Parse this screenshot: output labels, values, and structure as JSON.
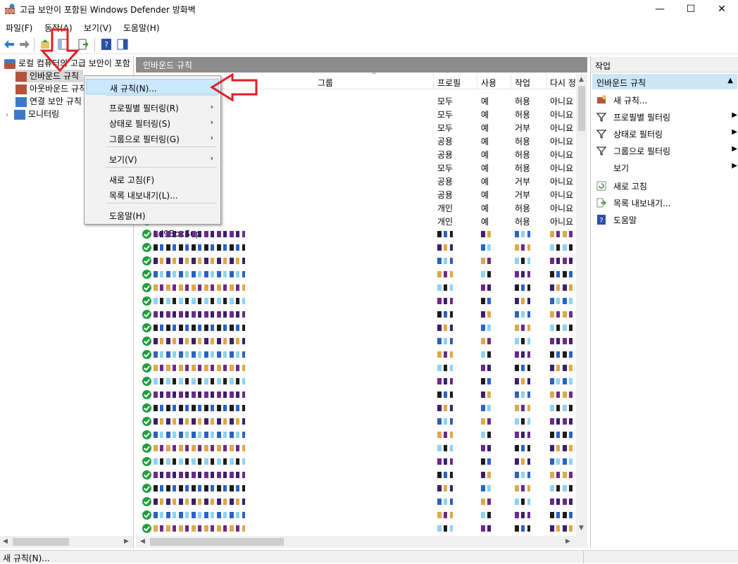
{
  "window": {
    "title": "고급 보안이 포함된 Windows Defender 방화벽",
    "minimize": "—",
    "maximize": "☐",
    "close": "✕"
  },
  "menubar": [
    "파일(F)",
    "동작(A)",
    "보기(V)",
    "도움말(H)"
  ],
  "tree": {
    "root": "로컬 컴퓨터의 고급 보안이 포함",
    "items": [
      "인바운드 규칙",
      "아웃바운드 규칙",
      "연결 보안 규칙",
      "모니터링"
    ]
  },
  "center": {
    "header": "인바운드 규칙",
    "columns": [
      "그룹",
      "프로필",
      "사용",
      "작업",
      "다시 정"
    ],
    "rows": [
      {
        "profile": "모두",
        "enabled": "예",
        "action": "허용",
        "override": "아니요"
      },
      {
        "profile": "모두",
        "enabled": "예",
        "action": "허용",
        "override": "아니요"
      },
      {
        "profile": "모두",
        "enabled": "예",
        "action": "거부",
        "override": "아니요"
      },
      {
        "profile": "공용",
        "enabled": "예",
        "action": "허용",
        "override": "아니요"
      },
      {
        "profile": "공용",
        "enabled": "예",
        "action": "허용",
        "override": "아니요"
      },
      {
        "profile": "모두",
        "enabled": "예",
        "action": "허용",
        "override": "아니요"
      },
      {
        "profile": "공용",
        "enabled": "예",
        "action": "거부",
        "override": "아니요"
      },
      {
        "profile": "공용",
        "enabled": "예",
        "action": "거부",
        "override": "아니요"
      },
      {
        "profile": "개인",
        "enabled": "예",
        "action": "허용",
        "override": "아니요"
      },
      {
        "profile": "개인",
        "enabled": "예",
        "action": "허용",
        "override": "아니요"
      }
    ],
    "partial_row_name": "Ld9BoxSup",
    "last_row": {
      "name": "SoftEther VPN Client Connection Mana...",
      "profile": "모두",
      "enabled": "예",
      "action": "허용",
      "override": "아니요"
    },
    "name_partial_label": "e"
  },
  "context_menu": {
    "items": [
      {
        "label": "새 규칙(N)...",
        "submenu": false
      },
      {
        "label": "프로필별 필터링(R)",
        "submenu": true
      },
      {
        "label": "상태로 필터링(S)",
        "submenu": true
      },
      {
        "label": "그룹으로 필터링(G)",
        "submenu": true
      },
      {
        "label": "보기(V)",
        "submenu": true
      },
      {
        "label": "새로 고침(F)",
        "submenu": false
      },
      {
        "label": "목록 내보내기(L)...",
        "submenu": false
      },
      {
        "label": "도움말(H)",
        "submenu": false
      }
    ],
    "submenu_arrow": "›"
  },
  "actions": {
    "header": "작업",
    "section": "인바운드 규칙",
    "section_toggle": "▲",
    "items": [
      {
        "label": "새 규칙...",
        "icon": "new-rule-icon",
        "submenu": false
      },
      {
        "label": "프로필별 필터링",
        "icon": "filter-icon",
        "submenu": true
      },
      {
        "label": "상태로 필터링",
        "icon": "filter-icon",
        "submenu": true
      },
      {
        "label": "그룹으로 필터링",
        "icon": "filter-icon",
        "submenu": true
      },
      {
        "label": "보기",
        "icon": "none",
        "submenu": true
      },
      {
        "label": "새로 고침",
        "icon": "refresh-icon",
        "submenu": false
      },
      {
        "label": "목록 내보내기...",
        "icon": "export-icon",
        "submenu": false
      },
      {
        "label": "도움말",
        "icon": "help-icon",
        "submenu": false
      }
    ],
    "submenu_arrow": "▶"
  },
  "status": "새 규칙(N)...",
  "colors": {
    "accent": "#cde6f7",
    "pane_header": "#8c8c8c",
    "annotation_arrow": "#e51c23",
    "allow_icon": "#1e9e3c"
  }
}
